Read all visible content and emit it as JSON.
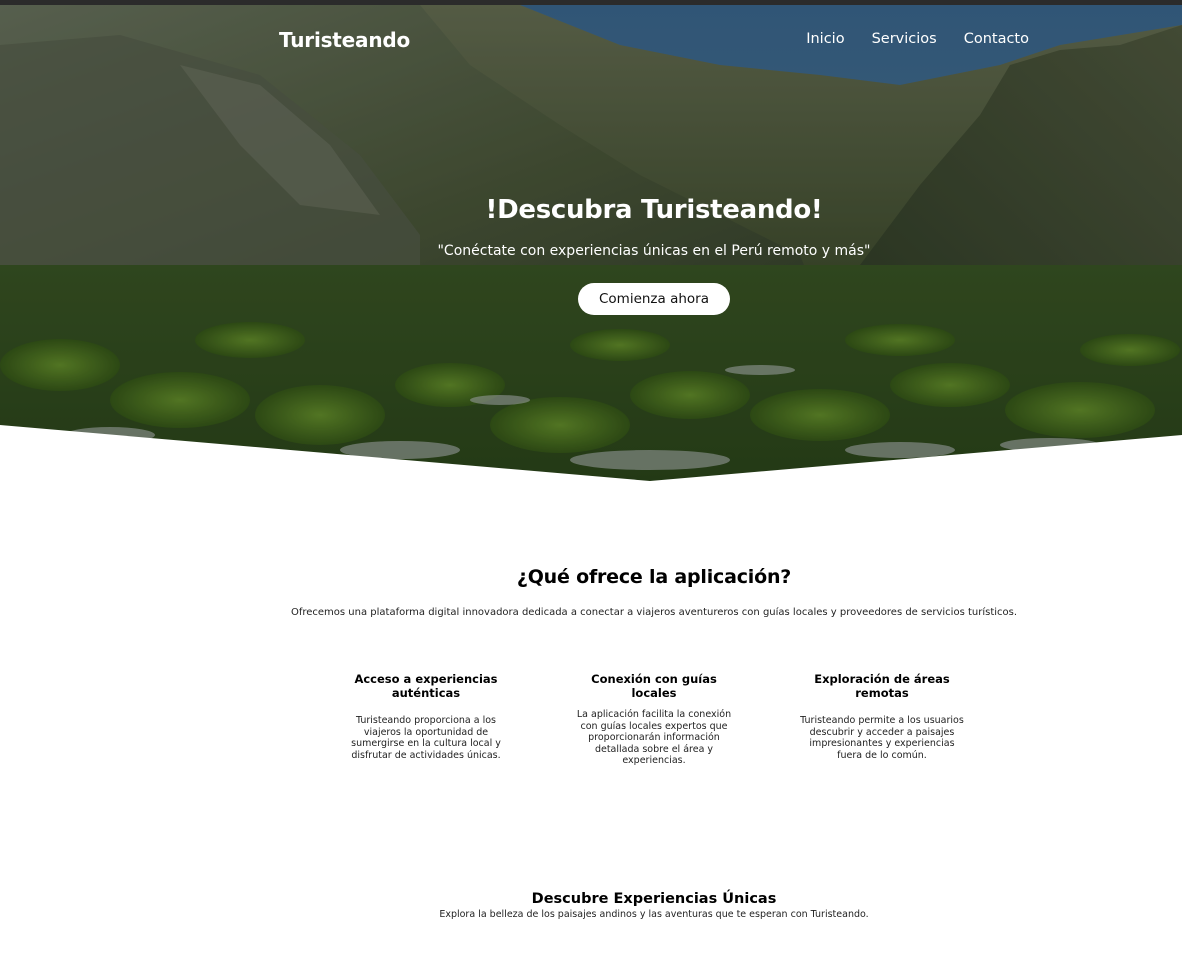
{
  "header": {
    "brand": "Turisteando",
    "nav": [
      {
        "label": "Inicio"
      },
      {
        "label": "Servicios"
      },
      {
        "label": "Contacto"
      }
    ]
  },
  "hero": {
    "title": "!Descubra Turisteando!",
    "subtitle": "\"Conéctate con experiencias únicas en el Perú remoto y más\"",
    "cta_label": "Comienza ahora"
  },
  "offer": {
    "title": "¿Qué ofrece la aplicación?",
    "description": "Ofrecemos una plataforma digital innovadora dedicada a conectar a viajeros aventureros con guías locales y proveedores de servicios turísticos.",
    "features": [
      {
        "title": "Acceso a experiencias auténticas",
        "text": "Turisteando proporciona a los viajeros la oportunidad de sumergirse en la cultura local y disfrutar de actividades únicas."
      },
      {
        "title": "Conexión con guías locales",
        "text": "La aplicación facilita la conexión con guías locales expertos que proporcionarán información detallada sobre el área y experiencias."
      },
      {
        "title": "Exploración de áreas remotas",
        "text": "Turisteando permite a los usuarios descubrir y acceder a paisajes impresionantes y experiencias fuera de lo común."
      }
    ]
  },
  "experiences": {
    "title": "Descubre Experiencias Únicas",
    "subtitle": "Explora la belleza de los paisajes andinos y las aventuras que te esperan con Turisteando."
  },
  "colors": {
    "hero_overlay": "#000000",
    "text_light": "#ffffff",
    "button_bg": "#ffffff",
    "page_bg": "#ffffff"
  }
}
